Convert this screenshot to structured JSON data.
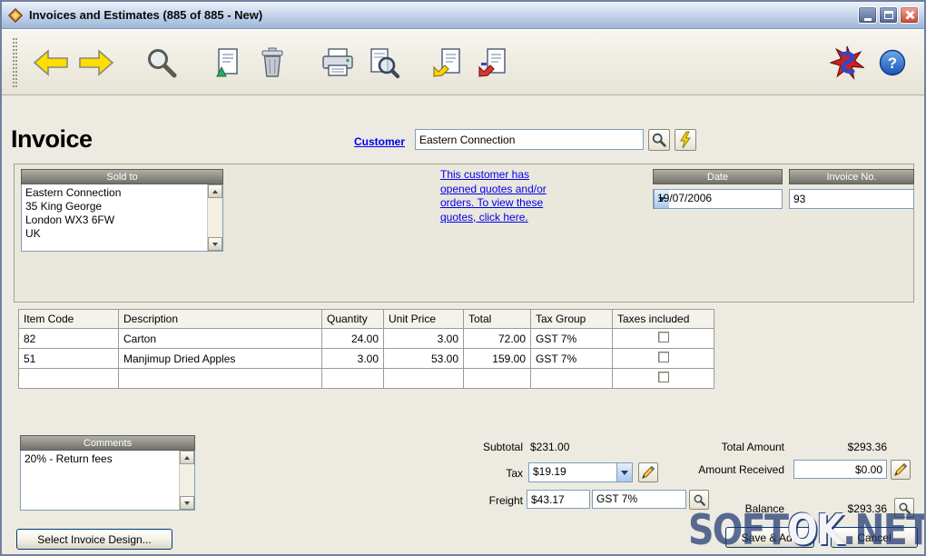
{
  "window": {
    "title": "Invoices and Estimates (885 of 885 - New)"
  },
  "toolbar": {
    "icon_names": [
      "back-arrow",
      "forward-arrow",
      "search",
      "new-record",
      "delete",
      "print",
      "print-preview",
      "copy-document",
      "transfer-document",
      "app-logo",
      "help"
    ],
    "help_glyph": "?"
  },
  "invoice": {
    "heading": "Invoice",
    "customer": {
      "label": "Customer",
      "value": "Eastern Connection"
    },
    "sold_to": {
      "header": "Sold to",
      "lines": [
        "Eastern Connection",
        "35 King George",
        "London  WX3 6FW",
        "UK"
      ]
    },
    "quotes_link": {
      "lines": [
        "This customer has",
        "opened quotes and/or",
        "orders. To view these",
        "quotes, click here."
      ]
    },
    "date": {
      "header": "Date",
      "value": "19/07/2006"
    },
    "invoice_no": {
      "header": "Invoice No.",
      "value": "93"
    }
  },
  "table": {
    "columns": [
      "Item Code",
      "Description",
      "Quantity",
      "Unit Price",
      "Total",
      "Tax Group",
      "Taxes included"
    ],
    "rows": [
      {
        "item_code": "82",
        "description": "Carton",
        "quantity": "24.00",
        "unit_price": "3.00",
        "total": "72.00",
        "tax_group": "GST 7%",
        "taxes_included": false
      },
      {
        "item_code": "51",
        "description": "Manjimup Dried Apples",
        "quantity": "3.00",
        "unit_price": "53.00",
        "total": "159.00",
        "tax_group": "GST 7%",
        "taxes_included": false
      },
      {
        "item_code": "",
        "description": "",
        "quantity": "",
        "unit_price": "",
        "total": "",
        "tax_group": "",
        "taxes_included": false
      }
    ]
  },
  "totals": {
    "comments": {
      "header": "Comments",
      "value": "20% - Return fees"
    },
    "subtotal_label": "Subtotal",
    "subtotal_value": "$231.00",
    "tax_label": "Tax",
    "tax_value": "$19.19",
    "freight_label": "Freight",
    "freight_value": "$43.17",
    "freight_tax_group": "GST 7%",
    "total_amount_label": "Total Amount",
    "total_amount_value": "$293.36",
    "amount_received_label": "Amount Received",
    "amount_received_value": "$0.00",
    "balance_label": "Balance",
    "balance_value": "$293.36"
  },
  "footer": {
    "select_design_label": "Select Invoice Design...",
    "save_add_label": "Save & Add",
    "cancel_label": "Cancel"
  },
  "watermark": {
    "prefix": "SOFT",
    "highlight": "OK",
    "suffix": ".NET"
  },
  "colors": {
    "link": "#0000EE",
    "panel_header_top": "#AFAFA7",
    "panel_header_bottom": "#71716A",
    "field_border": "#7F9DB9",
    "button_border": "#003C74",
    "titlebar_blue": "#9DB6D8",
    "close_red": "#C94A31"
  }
}
